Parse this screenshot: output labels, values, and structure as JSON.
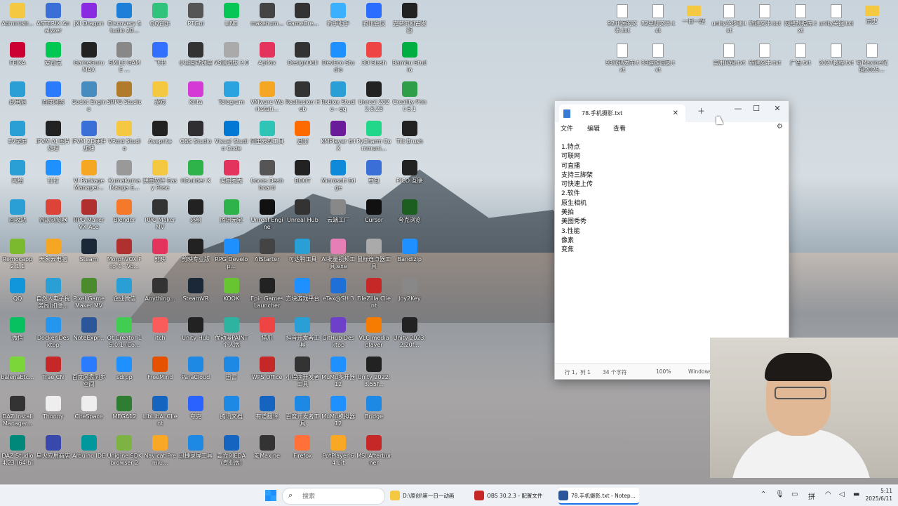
{
  "desktop_left": [
    {
      "label": "Administr...",
      "color": "#f5c842"
    },
    {
      "label": "ASTERIX Analyzer",
      "color": "#3a6fd8"
    },
    {
      "label": "JXI Dragon",
      "color": "#8a2be2"
    },
    {
      "label": "Discovery Studio 20...",
      "color": "#1e7fd8"
    },
    {
      "label": "QQ音乐",
      "color": "#31c27c"
    },
    {
      "label": "PTGui",
      "color": "#555"
    },
    {
      "label": "LINE",
      "color": "#06c755"
    },
    {
      "label": "makehum...",
      "color": "#444"
    },
    {
      "label": "GameCre...",
      "color": "#333"
    },
    {
      "label": "新手助手",
      "color": "#3ab0ff"
    },
    {
      "label": "腾讯会议",
      "color": "#2b6dff"
    },
    {
      "label": "克莱尔和古发版",
      "color": "#222"
    },
    {
      "label": "FEIKA",
      "color": "#c03"
    },
    {
      "label": "爱奇艺",
      "color": "#00c853"
    },
    {
      "label": "GameGuru MAX",
      "color": "#222"
    },
    {
      "label": "SMILE GAME ...",
      "color": "#888"
    },
    {
      "label": "飞书",
      "color": "#3370ff"
    },
    {
      "label": "小熊互动课堂",
      "color": "#333"
    },
    {
      "label": "VS测试版 2.0",
      "color": "#aaa"
    },
    {
      "label": "Apifox",
      "color": "#e4335c"
    },
    {
      "label": "DesignDoll",
      "color": "#333"
    },
    {
      "label": "DevEco Studio",
      "color": "#1e90ff"
    },
    {
      "label": "3D Slash",
      "color": "#e44"
    },
    {
      "label": "Bambu Studio",
      "color": "#00ae42"
    },
    {
      "label": "此电脑",
      "color": "#2a9fd6"
    },
    {
      "label": "百度网盘",
      "color": "#2b7bff"
    },
    {
      "label": "Godot Engine",
      "color": "#478cbf"
    },
    {
      "label": "SRPG Studio",
      "color": "#b07c2c"
    },
    {
      "label": "游戏",
      "color": "#f5c842"
    },
    {
      "label": "Krita",
      "color": "#d63ad6"
    },
    {
      "label": "Telegram",
      "color": "#2aa3e0"
    },
    {
      "label": "VMware Workstati...",
      "color": "#f5a623"
    },
    {
      "label": "Reallusion Hub",
      "color": "#333"
    },
    {
      "label": "Roblox Studio - qq",
      "color": "#2a9fd6"
    },
    {
      "label": "Unreal 2022.8.23",
      "color": "#222"
    },
    {
      "label": "Creality Print 6.1",
      "color": "#2e9e48"
    },
    {
      "label": "EV录屏",
      "color": "#2a9fd6"
    },
    {
      "label": "IPVM AI 图片处理",
      "color": "#222"
    },
    {
      "label": "IPVM 2D硬件加速",
      "color": "#3a6fd8"
    },
    {
      "label": "VRoid Studio",
      "color": "#f5c842"
    },
    {
      "label": "Aseprite",
      "color": "#222"
    },
    {
      "label": "OBS Studio",
      "color": "#302e31"
    },
    {
      "label": "Visual Studio Code",
      "color": "#0078d4"
    },
    {
      "label": "阿里云盘工具",
      "color": "#2ec4b6"
    },
    {
      "label": "迅雷",
      "color": "#ff6a00"
    },
    {
      "label": "KMPlayer 64X",
      "color": "#6a1b9a"
    },
    {
      "label": "PyCharm Communi...",
      "color": "#21d789"
    },
    {
      "label": "Tilt Brush",
      "color": "#222"
    },
    {
      "label": "网络",
      "color": "#2a9fd6"
    },
    {
      "label": "钉钉",
      "color": "#1e90ff"
    },
    {
      "label": "VI Package Manager...",
      "color": "#f5a623"
    },
    {
      "label": "KumaKuma Manga E...",
      "color": "#999"
    },
    {
      "label": "拼图软件 Easy Pose",
      "color": "#f5c842"
    },
    {
      "label": "HBuilder X",
      "color": "#2eb34b"
    },
    {
      "label": "美图秀秀",
      "color": "#e4335c"
    },
    {
      "label": "Cocos Dashboard",
      "color": "#555"
    },
    {
      "label": "BOOT",
      "color": "#222"
    },
    {
      "label": "Microsoft Edge",
      "color": "#0f8ad8"
    },
    {
      "label": "豆包",
      "color": "#3a6fd8"
    },
    {
      "label": "PICO 互联",
      "color": "#222"
    },
    {
      "label": "回收站",
      "color": "#2a9fd6"
    },
    {
      "label": "谷歌浏览器",
      "color": "#db4437"
    },
    {
      "label": "RPG Maker VX Ace",
      "color": "#b03030"
    },
    {
      "label": "Blender",
      "color": "#f5792a"
    },
    {
      "label": "RPG Maker MV",
      "color": "#333"
    },
    {
      "label": "必剪",
      "color": "#222"
    },
    {
      "label": "腾讯元宝",
      "color": "#2eb34b"
    },
    {
      "label": "Unreal Engine",
      "color": "#111"
    },
    {
      "label": "Unreal Hub",
      "color": "#333"
    },
    {
      "label": "云端工厂",
      "color": "#888"
    },
    {
      "label": "Cursor",
      "color": "#111"
    },
    {
      "label": "夸克浏览",
      "color": "#1b5e20"
    },
    {
      "label": "Remocapp 2.1.1",
      "color": "#7bb92f"
    },
    {
      "label": "天象云电脑",
      "color": "#f5a623"
    },
    {
      "label": "Steam",
      "color": "#1b2838"
    },
    {
      "label": "MorphVOX Pro 4 - Vo...",
      "color": "#b03030"
    },
    {
      "label": "剪映",
      "color": "#e4335c"
    },
    {
      "label": "剪映专业版",
      "color": "#222"
    },
    {
      "label": "RPG Develop...",
      "color": "#1e90ff"
    },
    {
      "label": "AIStarter",
      "color": "#444"
    },
    {
      "label": "可达鸭工具",
      "color": "#2a9fd6"
    },
    {
      "label": "AI批量视频工具.exe",
      "color": "#e57fb5"
    },
    {
      "label": "鼠标连点器工具",
      "color": "#aaa"
    },
    {
      "label": "Bandizip",
      "color": "#1e90ff"
    },
    {
      "label": "QQ",
      "color": "#1296db"
    },
    {
      "label": "自然人电子税务局(扣缴...",
      "color": "#2a9fd6"
    },
    {
      "label": "Pixel Game Maker MV",
      "color": "#4a8b2c"
    },
    {
      "label": "企业微信",
      "color": "#2a9fd6"
    },
    {
      "label": "Anything...",
      "color": "#333"
    },
    {
      "label": "SteamVR",
      "color": "#1b2838"
    },
    {
      "label": "KOOK",
      "color": "#66c531"
    },
    {
      "label": "Epic Games Launcher",
      "color": "#222"
    },
    {
      "label": "方块游戏平台",
      "color": "#1e90ff"
    },
    {
      "label": "eTax@SH 3",
      "color": "#1e6fd8"
    },
    {
      "label": "FileZilla Client",
      "color": "#c62828"
    },
    {
      "label": "Joy2Key",
      "color": "#888"
    },
    {
      "label": "微信",
      "color": "#07c160"
    },
    {
      "label": "Docker Desktop",
      "color": "#2496ed"
    },
    {
      "label": "NoteExpr...",
      "color": "#2b579a"
    },
    {
      "label": "Qt Creator 15.0.1 (Co...",
      "color": "#41cd52"
    },
    {
      "label": "itch",
      "color": "#fa5c5c"
    },
    {
      "label": "Unity Hub",
      "color": "#222"
    },
    {
      "label": "优动漫PAINT 个人版",
      "color": "#2eb3a0"
    },
    {
      "label": "猫爪",
      "color": "#e44"
    },
    {
      "label": "抖音开发者工具",
      "color": "#2a9fd6"
    },
    {
      "label": "GitHub Desktop",
      "color": "#6e40c9"
    },
    {
      "label": "VLC media player",
      "color": "#f57c00"
    },
    {
      "label": "Unity 2023.2.20f...",
      "color": "#222"
    },
    {
      "label": "balenaEtc...",
      "color": "#7bd63a"
    },
    {
      "label": "Trae CN",
      "color": "#c62828"
    },
    {
      "label": "百度网盘同步空间",
      "color": "#2b7bff"
    },
    {
      "label": "sdrpp",
      "color": "#1e90ff"
    },
    {
      "label": "FreeMind",
      "color": "#e65100"
    },
    {
      "label": "ParaCloud",
      "color": "#1e88e5"
    },
    {
      "label": "迅雷",
      "color": "#1e88e5"
    },
    {
      "label": "WPS Office",
      "color": "#c62828"
    },
    {
      "label": "小程序开发者工具",
      "color": "#333"
    },
    {
      "label": "MuMu多开器12",
      "color": "#1e90ff"
    },
    {
      "label": "Unity 2022.3.55f...",
      "color": "#222"
    },
    {
      "label": "",
      "color": "transparent"
    },
    {
      "label": "DAZ Install Manager...",
      "color": "#333"
    },
    {
      "label": "Thonny",
      "color": "#eee"
    },
    {
      "label": "CiteSpace",
      "color": "#eee"
    },
    {
      "label": "MEGA12",
      "color": "#2e7d32"
    },
    {
      "label": "LibLibAI Client",
      "color": "#1565c0"
    },
    {
      "label": "夸克",
      "color": "#2962ff"
    },
    {
      "label": "腾讯文档",
      "color": "#1e88e5"
    },
    {
      "label": "有道翻译",
      "color": "#1565c0"
    },
    {
      "label": "百度开发者工具",
      "color": "#1e88e5"
    },
    {
      "label": "MuMu模拟器12",
      "color": "#1e90ff"
    },
    {
      "label": "Bridge",
      "color": "#1e88e5"
    },
    {
      "label": "",
      "color": "transparent"
    },
    {
      "label": "DAZ Studio 4.23 (64-bit)",
      "color": "#00897b"
    },
    {
      "label": "星火应用商店",
      "color": "#3949ab"
    },
    {
      "label": "Arduino IDE",
      "color": "#00979d"
    },
    {
      "label": "Unigine SDK browser 2",
      "color": "#7cb342"
    },
    {
      "label": "Navicat Premiu...",
      "color": "#f9a825"
    },
    {
      "label": "迅捷录屏工具",
      "color": "#1e88e5"
    },
    {
      "label": "嘉立创EDA(专业版)",
      "color": "#1565c0"
    },
    {
      "label": "安Maxine",
      "color": "#333"
    },
    {
      "label": "Firefox",
      "color": "#ff7139"
    },
    {
      "label": "PotPlayer 64 bit",
      "color": "#f9a825"
    },
    {
      "label": "MSI Afterburner",
      "color": "#c62828"
    },
    {
      "label": "",
      "color": "transparent"
    }
  ],
  "desktop_right": [
    {
      "label": "92开源的文本.txt",
      "type": "file"
    },
    {
      "label": "82星际文本.txt",
      "type": "file"
    },
    {
      "label": "一日一题",
      "type": "folder"
    },
    {
      "label": "unity多步骤.txt",
      "type": "file"
    },
    {
      "label": "新建文本.txt",
      "type": "file"
    },
    {
      "label": "网络数据库.txt",
      "type": "file"
    },
    {
      "label": "unity关键.txt",
      "type": "file"
    },
    {
      "label": "历史",
      "type": "folder"
    },
    {
      "label": "93代码发布.txt",
      "type": "file"
    },
    {
      "label": "83运维记录.txt",
      "type": "file"
    },
    {
      "label": "",
      "type": "none"
    },
    {
      "label": "实用代码.txt",
      "type": "file"
    },
    {
      "label": "新建文本.txt",
      "type": "file"
    },
    {
      "label": "广告.txt",
      "type": "file"
    },
    {
      "label": "2027教程.txt",
      "type": "file"
    },
    {
      "label": "写Maxine代码2025...",
      "type": "file"
    }
  ],
  "notepad": {
    "tab_title": "78.手机摄影.txt",
    "menu": {
      "file": "文件",
      "edit": "编辑",
      "view": "查看"
    },
    "lines": [
      "1.特点",
      "可联网",
      "可直播",
      "支持三脚架",
      "可快速上传",
      "2.软件",
      "原生相机",
      "美拍",
      "美图秀秀",
      "3.性能",
      "像素",
      "变焦"
    ],
    "status": {
      "position": "行 1，列 1",
      "chars": "34 个字符",
      "zoom": "100%",
      "encoding": "Windows"
    }
  },
  "taskbar": {
    "search_placeholder": "搜索",
    "apps": [
      {
        "label": "D:\\原创\\第一日一动画",
        "color": "#f5c842"
      },
      {
        "label": "OBS 30.2.3 - 配置文件",
        "color": "#c62828"
      },
      {
        "label": "78.手机摄影.txt - Notep...",
        "color": "#2b579a"
      }
    ],
    "ime_lang": "拼",
    "time": "5:11",
    "date": "2025/6/11"
  }
}
